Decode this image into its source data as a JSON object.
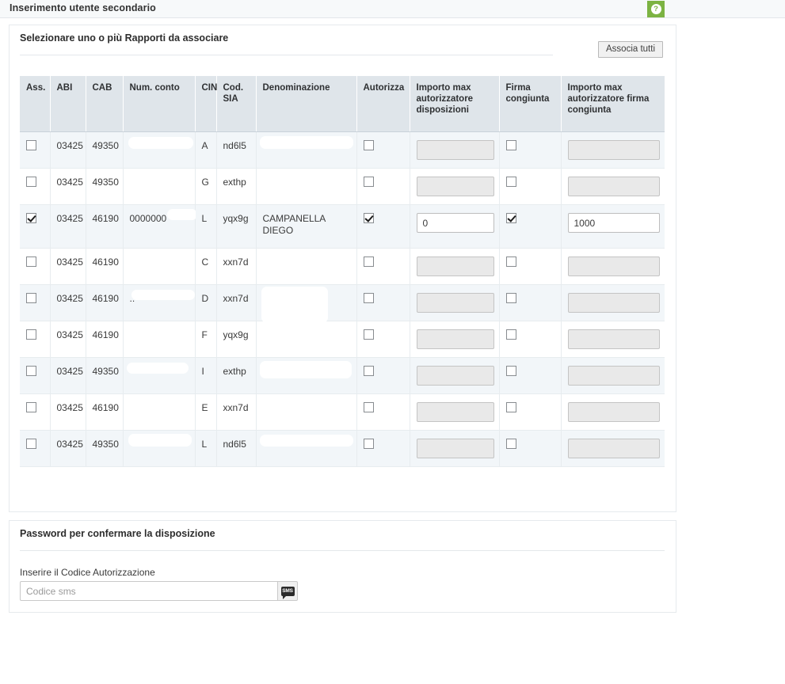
{
  "header": {
    "title": "Inserimento utente secondario",
    "help_icon": "help-question-icon",
    "help_symbol": "?"
  },
  "rapporti_panel": {
    "heading": "Selezionare uno o più Rapporti da associare",
    "associa_tutti_label": "Associa tutti",
    "columns": [
      "Ass.",
      "ABI",
      "CAB",
      "Num. conto",
      "CIN",
      "Cod. SIA",
      "Denominazione",
      "Autorizza",
      "Importo max autorizzatore disposizioni",
      "Firma congiunta",
      "Importo max autorizzatore firma congiunta"
    ],
    "rows": [
      {
        "ass_checked": false,
        "abi": "03425",
        "cab": "49350",
        "num_conto": "",
        "cin": "A",
        "cod_sia": "nd6l5",
        "denominazione": "",
        "autorizza_checked": false,
        "importo_max": "",
        "firma_checked": false,
        "importo_max_firma": "",
        "inputs_enabled": false
      },
      {
        "ass_checked": false,
        "abi": "03425",
        "cab": "49350",
        "num_conto": "",
        "cin": "G",
        "cod_sia": "exthp",
        "denominazione": "",
        "autorizza_checked": false,
        "importo_max": "",
        "firma_checked": false,
        "importo_max_firma": "",
        "inputs_enabled": false
      },
      {
        "ass_checked": true,
        "abi": "03425",
        "cab": "46190",
        "num_conto": "0000000",
        "cin": "L",
        "cod_sia": "yqx9g",
        "denominazione": "CAMPANELLA DIEGO",
        "autorizza_checked": true,
        "importo_max": "0",
        "firma_checked": true,
        "importo_max_firma": "1000",
        "inputs_enabled": true
      },
      {
        "ass_checked": false,
        "abi": "03425",
        "cab": "46190",
        "num_conto": "",
        "cin": "C",
        "cod_sia": "xxn7d",
        "denominazione": "",
        "autorizza_checked": false,
        "importo_max": "",
        "firma_checked": false,
        "importo_max_firma": "",
        "inputs_enabled": false
      },
      {
        "ass_checked": false,
        "abi": "03425",
        "cab": "46190",
        "num_conto": "..",
        "cin": "D",
        "cod_sia": "xxn7d",
        "denominazione": "",
        "autorizza_checked": false,
        "importo_max": "",
        "firma_checked": false,
        "importo_max_firma": "",
        "inputs_enabled": false
      },
      {
        "ass_checked": false,
        "abi": "03425",
        "cab": "46190",
        "num_conto": "",
        "cin": "F",
        "cod_sia": "yqx9g",
        "denominazione": "",
        "autorizza_checked": false,
        "importo_max": "",
        "firma_checked": false,
        "importo_max_firma": "",
        "inputs_enabled": false
      },
      {
        "ass_checked": false,
        "abi": "03425",
        "cab": "49350",
        "num_conto": "",
        "cin": "I",
        "cod_sia": "exthp",
        "denominazione": "",
        "autorizza_checked": false,
        "importo_max": "",
        "firma_checked": false,
        "importo_max_firma": "",
        "inputs_enabled": false
      },
      {
        "ass_checked": false,
        "abi": "03425",
        "cab": "46190",
        "num_conto": "",
        "cin": "E",
        "cod_sia": "xxn7d",
        "denominazione": "",
        "autorizza_checked": false,
        "importo_max": "",
        "firma_checked": false,
        "importo_max_firma": "",
        "inputs_enabled": false
      },
      {
        "ass_checked": false,
        "abi": "03425",
        "cab": "49350",
        "num_conto": "",
        "cin": "L",
        "cod_sia": "nd6l5",
        "denominazione": "",
        "autorizza_checked": false,
        "importo_max": "",
        "firma_checked": false,
        "importo_max_firma": "",
        "inputs_enabled": false
      }
    ]
  },
  "password_panel": {
    "heading": "Password per confermare la disposizione",
    "auth_code_label": "Inserire il Codice Autorizzazione",
    "auth_code_value": "",
    "auth_code_placeholder": "Codice sms",
    "sms_icon": "sms-bubble-icon",
    "sms_icon_text": "SMS"
  },
  "colors": {
    "accent_green": "#7cb342",
    "header_bg": "#dfe5ea",
    "stripe": "#f2f6f9",
    "page_bg": "#ffffff",
    "top_bar_bg": "#f7f9fa"
  }
}
